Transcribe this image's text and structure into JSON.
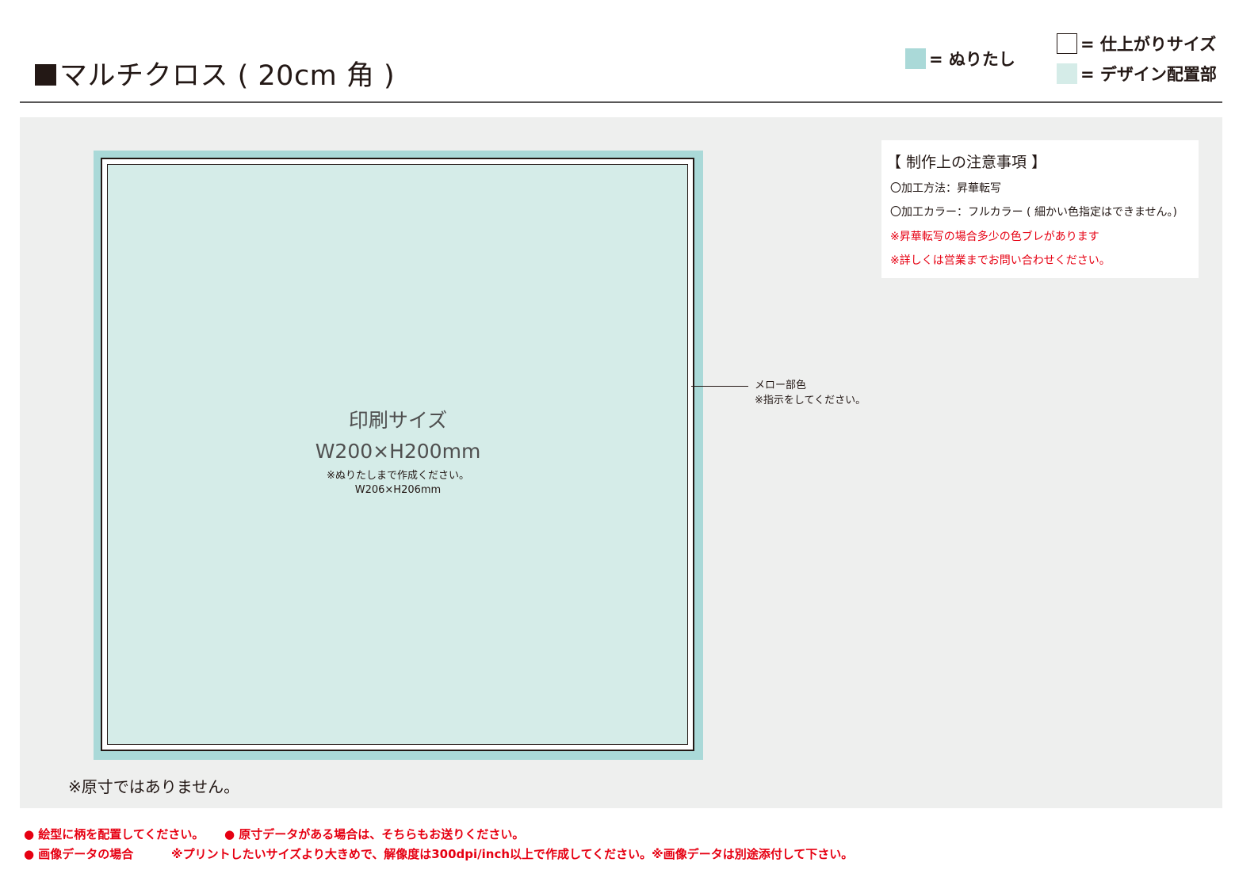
{
  "header": {
    "title": "マルチクロス ( 20cm 角 )",
    "legend": {
      "bleed": "= ぬりたし",
      "finish": "= 仕上がりサイズ",
      "design": "= デザイン配置部"
    }
  },
  "colors": {
    "bleed": "#aad9d8",
    "design": "#d5ece8",
    "panel": "#eeefee",
    "red": "#e60012",
    "ink": "#231815"
  },
  "template": {
    "print_label": "印刷サイズ",
    "print_size": "W200×H200mm",
    "bleed_note": "※ぬりたしまで作成ください。",
    "bleed_size": "W206×H206mm",
    "mellow_label": "メロー部色",
    "mellow_note": "※指示をしてください。",
    "scale_note": "※原寸ではありません。"
  },
  "notes": {
    "title": "【 制作上の注意事項 】",
    "items": [
      "〇加工方法：昇華転写",
      "〇加工カラー：フルカラー ( 細かい色指定はできません。)",
      "※昇華転写の場合多少の色ブレがあります",
      "※詳しくは営業までお問い合わせください。"
    ]
  },
  "footer": {
    "line1_a": "● 絵型に柄を配置してください。",
    "line1_b": "● 原寸データがある場合は、そちらもお送りください。",
    "line2_a": "● 画像データの場合",
    "line2_b": "※プリントしたいサイズより大きめで、解像度は300dpi/inch以上で作成してください。※画像データは別途添付して下さい。"
  }
}
